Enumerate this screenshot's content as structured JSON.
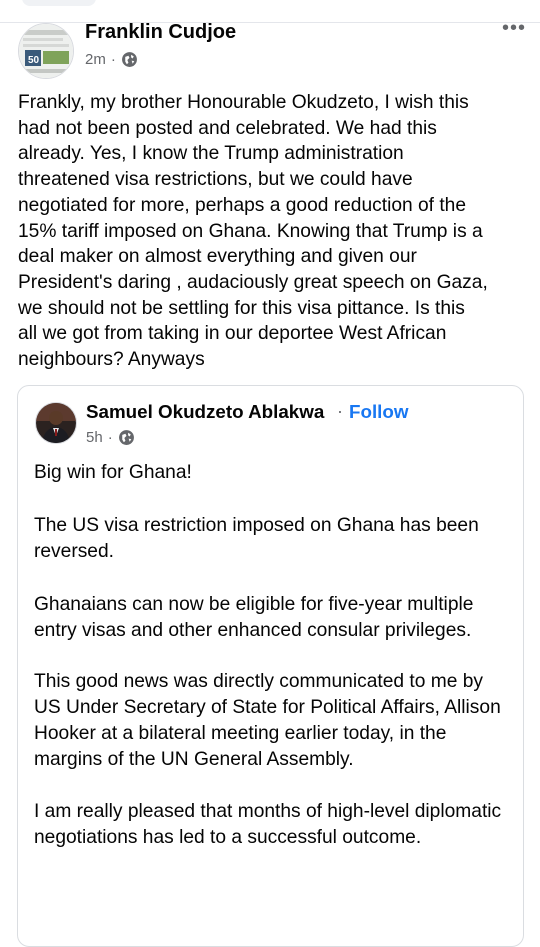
{
  "post": {
    "author": "Franklin Cudjoe",
    "time": "2m",
    "separator": "·",
    "more_label": "•••",
    "body": "Frankly, my brother Honourable Okudzeto, I wish this\nhad not been posted and celebrated. We had this\nalready. Yes, I know the Trump administration\nthreatened  visa restrictions, but we could have\nnegotiated for more, perhaps a good reduction of the\n15% tariff imposed on Ghana. Knowing that  Trump is a\ndeal maker on almost everything and given our\nPresident's daring , audaciously  great speech on Gaza,\nwe should not be settling for this visa pittance. Is this\nall we got from taking in our deportee West African\nneighbours?  Anyways"
  },
  "shared": {
    "author": "Samuel Okudzeto Ablakwa",
    "separator": "·",
    "follow_label": "Follow",
    "time": "5h",
    "paragraphs": [
      "Big win for Ghana!",
      "The US visa restriction imposed on Ghana has been reversed.",
      "Ghanaians can now be eligible for five-year multiple entry visas and other enhanced consular privileges.",
      "This good news was directly communicated to me by US Under Secretary of State for Political Affairs, Allison Hooker at a bilateral meeting earlier today, in the margins of the UN General Assembly.",
      "I am really pleased that months of high-level diplomatic negotiations has led to a successful outcome."
    ]
  },
  "colors": {
    "link": "#1877f2",
    "secondary_text": "#65676b",
    "border": "#dadde1"
  },
  "icons": {
    "privacy": "globe-icon",
    "more": "more-options-icon"
  }
}
